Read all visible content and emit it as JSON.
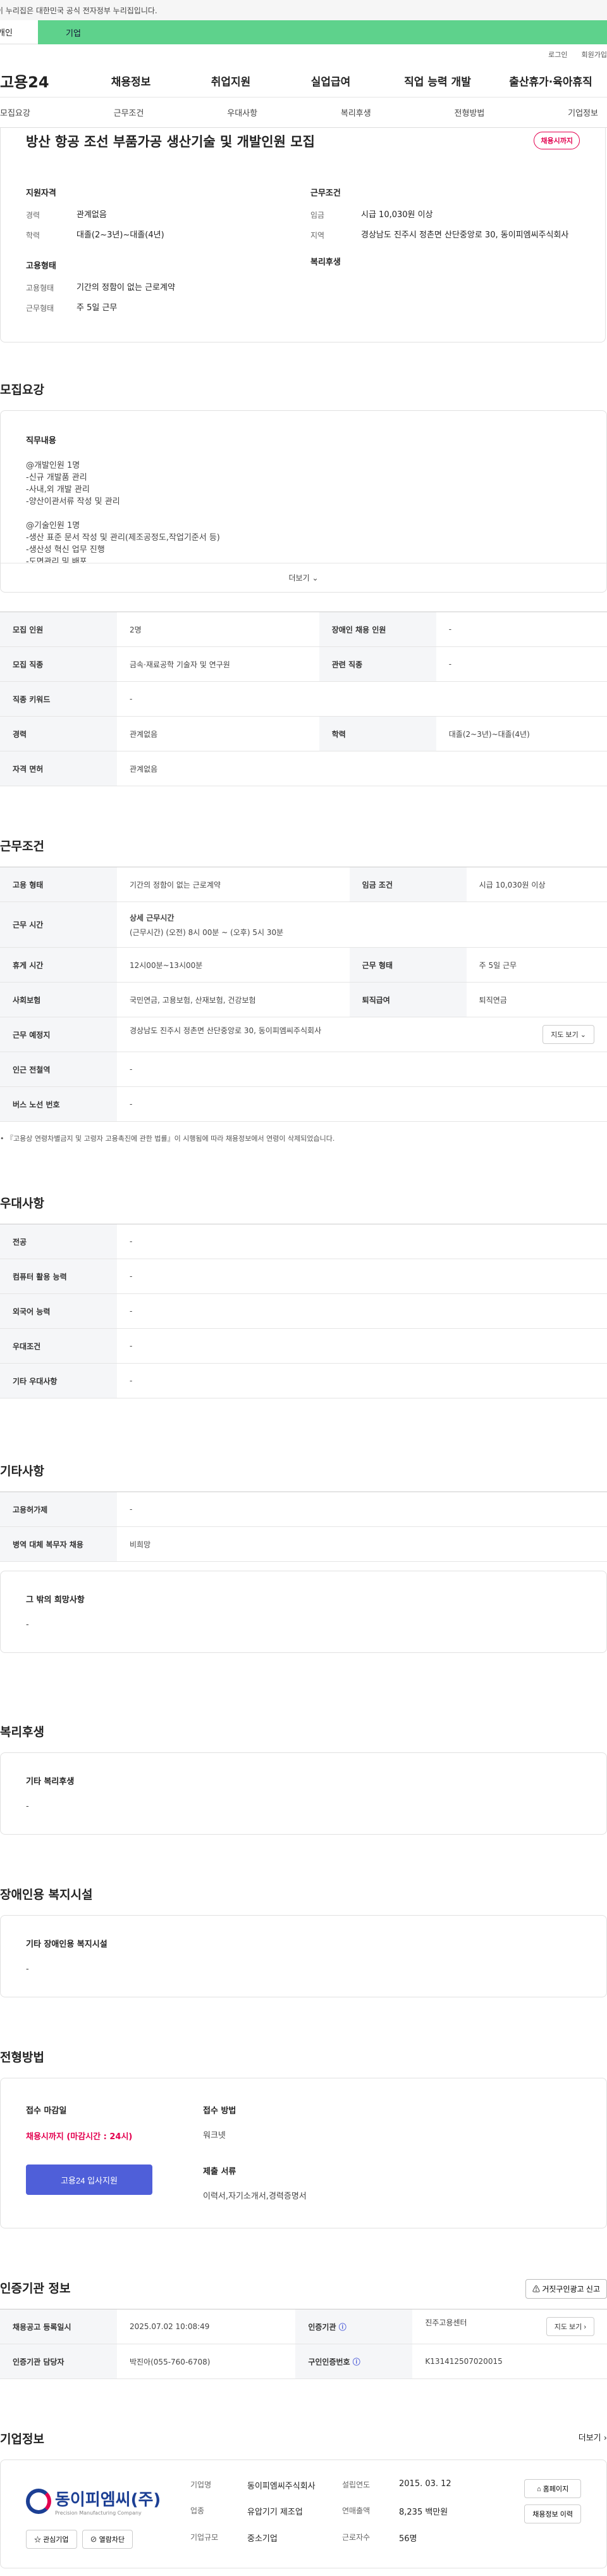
{
  "gov_notice": "이 누리집은 대한민국 공식 전자정부 누리집입니다.",
  "top_tabs": {
    "person": "개인",
    "biz": "기업"
  },
  "util_links": [
    "로그인",
    "회원가입"
  ],
  "logo": "고용24",
  "gnb": [
    "채용정보",
    "취업지원",
    "실업급여",
    "직업 능력 개발",
    "출산휴가·육아휴직"
  ],
  "snb": [
    "모집요강",
    "근무조건",
    "우대사항",
    "복리후생",
    "전형방법",
    "기업정보"
  ],
  "job": {
    "title": "방산 항공 조선 부품가공 생산기술 및 개발인원 모집",
    "badge": "채용시까지",
    "qual_h": "지원자격",
    "career_k": "경력",
    "career_v": "관계없음",
    "edu_k": "학력",
    "edu_v": "대졸(2~3년)~대졸(4년)",
    "emptype_h": "고용형태",
    "emptype_k": "고용형태",
    "emptype_v": "기간의 정함이 없는 근로계약",
    "workform_k": "근무형태",
    "workform_v": "주 5일 근무",
    "cond_h": "근무조건",
    "wage_k": "임금",
    "wage_v": "시급 10,030원 이상",
    "region_k": "지역",
    "region_v": "경상남도 진주시 정촌면 산단중앙로 30, 동이피엠씨주식회사",
    "welfare_h": "복리후생"
  },
  "recruit": {
    "title": "모집요강",
    "duty_h": "직무내용",
    "duty_text": "@개발인원 1명\n-신규 개발품 관리\n-사내,외 개발 관리\n-양산이관서류 작성 및 관리\n\n@기술인원 1명\n-생산 표준 문서 작성 및 관리(제조공정도,작업기준서 등)\n-생산성 혁신 업무 진행\n-도면관리 및 배포",
    "more": "더보기",
    "rows": [
      [
        "모집 인원",
        "2명",
        "장애인 채용 인원",
        "-"
      ],
      [
        "모집 직종",
        "금속·재료공학 기술자 및 연구원",
        "관련 직종",
        "-"
      ],
      [
        "직종 키워드",
        "-"
      ],
      [
        "경력",
        "관계없음",
        "학력",
        "대졸(2~3년)~대졸(4년)"
      ],
      [
        "자격 면허",
        "관계없음"
      ]
    ]
  },
  "work": {
    "title": "근무조건",
    "emp_k": "고용 형태",
    "emp_v": "기간의 정함이 없는 근로계약",
    "wage_k": "임금 조건",
    "wage_v": "시급 10,030원 이상",
    "time_k": "근무 시간",
    "time_sub": "상세 근무시간",
    "time_v": "(근무시간) (오전) 8시 00분 ~ (오후) 5시 30분",
    "rest_k": "휴게 시간",
    "rest_v": "12시00분~13시00분",
    "form_k": "근무 형태",
    "form_v": "주 5일 근무",
    "ins_k": "사회보험",
    "ins_v": "국민연금, 고용보험, 산재보험, 건강보험",
    "ret_k": "퇴직급여",
    "ret_v": "퇴직연금",
    "place_k": "근무 예정지",
    "place_v": "경상남도 진주시 정촌면 산단중앙로 30, 동이피엠씨주식회사",
    "map_btn": "지도 보기",
    "station_k": "인근 전철역",
    "station_v": "-",
    "bus_k": "버스 노선 번호",
    "bus_v": "-",
    "note": "• 『고용상 연령차별금지 및 고령자 고용촉진에 관한 법률』이 시행됨에 따라 채용정보에서 연령이 삭제되었습니다."
  },
  "pref": {
    "title": "우대사항",
    "rows": [
      [
        "전공",
        "-"
      ],
      [
        "컴퓨터 활용 능력",
        "-"
      ],
      [
        "외국어 능력",
        "-"
      ],
      [
        "우대조건",
        "-"
      ],
      [
        "기타 우대사항",
        "-"
      ]
    ]
  },
  "etc": {
    "title": "기타사항",
    "rows": [
      [
        "고용허가제",
        "-"
      ],
      [
        "병역 대체 복무자 채용",
        "비희망"
      ]
    ],
    "box_h": "그 밖의 희망사항",
    "box_v": "-"
  },
  "welfare": {
    "title": "복리후생",
    "box_h": "기타 복리후생",
    "box_v": "-"
  },
  "disabled": {
    "title": "장애인용 복지시설",
    "box_h": "기타 장애인용 복지시설",
    "box_v": "-"
  },
  "select": {
    "title": "전형방법",
    "deadline_h": "접수 마감일",
    "deadline_v": "채용시까지 (마감시간 : 24시)",
    "method_h": "접수 방법",
    "method_v": "워크넷",
    "docs_h": "제출 서류",
    "docs_v": "이력서,자기소개서,경력증명서",
    "apply_btn": "고용24 입사지원"
  },
  "cert": {
    "title": "인증기관 정보",
    "report_btn": "거짓구인광고 신고",
    "reg_k": "채용공고 등록일시",
    "reg_v": "2025.07.02 10:08:49",
    "org_k": "인증기관",
    "org_v": "진주고용센터",
    "map_btn": "지도 보기",
    "mgr_k": "인증기관 담당자",
    "mgr_v": "박진아(055-760-6708)",
    "num_k": "구인인증번호",
    "num_v": "K131412507020015"
  },
  "company": {
    "title": "기업정보",
    "more": "더보기",
    "logo_text": "동이피엠씨(주)",
    "logo_sub": "Precision Manufacturing Company",
    "interest_btn": "관심기업",
    "block_btn": "열람차단",
    "name_k": "기업명",
    "name_v": "동이피엠씨주식회사",
    "year_k": "설립연도",
    "year_v": "2015. 03. 12",
    "ind_k": "업종",
    "ind_v": "유압기기 제조업",
    "sales_k": "연매출액",
    "sales_v": "8,235 백만원",
    "size_k": "기업규모",
    "size_v": "중소기업",
    "emp_k": "근로자수",
    "emp_v": "56명",
    "home_btn": "홈페이지",
    "history_btn": "채용정보 이력"
  }
}
